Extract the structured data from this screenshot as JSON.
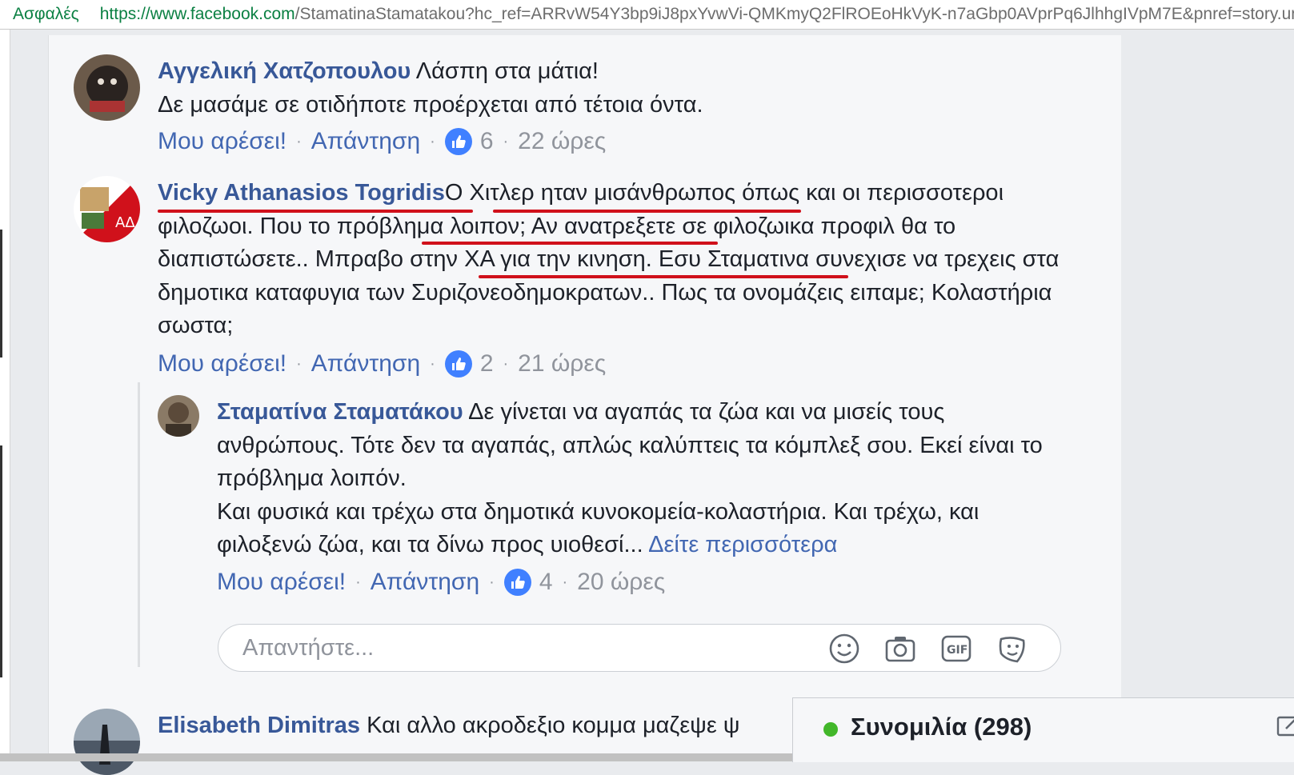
{
  "browser": {
    "secure_label": "Ασφαλές",
    "url_host": "https://www.facebook.com",
    "url_path": "/StamatinaStamatakou?hc_ref=ARRvW54Y3bp9iJ8pxYvwVi-QMKmyQ2FlROEoHkVyK-n7aGbp0AVprPq6JlhhgIVpM7E&pnref=story.un"
  },
  "comments": [
    {
      "author": "Αγγελική Χατζοπουλου",
      "text_line1": "Λάσπη στα μάτια!",
      "text_line2": "Δε μασάμε σε οτιδήποτε προέρχεται από τέτοια όντα.",
      "like_label": "Μου αρέσει!",
      "reply_label": "Απάντηση",
      "likes": "6",
      "time": "22 ώρες"
    },
    {
      "author": "Vicky Athanasios Togridis",
      "seg1": "Ο ",
      "seg2": "Χιτλερ ηταν μισάνθρωπος",
      "seg3": " όπως και οι περισσοτεροι φιλοζωοι. ",
      "seg4": "Που το πρόβλημα λοιπον;",
      "seg5": " Αν ανατρεξετε σε φιλοζωικα προφιλ θα το διαπιστώσετε.. ",
      "seg6": "Μπραβο στην ΧΑ για την κινηση",
      "seg7": ". Εσυ Σταματινα συνεχισε να τρεχεις στα δημοτικα καταφυγια των Συριζονεοδημοκρατων.. Πως τα ονομάζεις ειπαμε; Κολαστήρια σωστα;",
      "like_label": "Μου αρέσει!",
      "reply_label": "Απάντηση",
      "likes": "2",
      "time": "21 ώρες"
    },
    {
      "author": "Σταματίνα Σταματάκου",
      "text_line1": "Δε γίνεται να αγαπάς τα ζώα και να μισείς τους ανθρώπους. Τότε δεν τα αγαπάς, απλώς καλύπτεις τα κόμπλεξ σου. Εκεί είναι το πρόβλημα λοιπόν.",
      "text_line2": "Και φυσικά και τρέχω στα δημοτικά κυνοκομεία-κολαστήρια. Και τρέχω, και φιλοξενώ ζώα, και τα δίνω προς υιοθεσί...",
      "more": "Δείτε περισσότερα",
      "like_label": "Μου αρέσει!",
      "reply_label": "Απάντηση",
      "likes": "4",
      "time": "20 ώρες"
    },
    {
      "author": "Elisabeth Dimitras",
      "text": "Και αλλο ακροδεξιο κομμα μαζεψε ψ"
    }
  ],
  "reply_box": {
    "placeholder": "Απαντήστε..."
  },
  "chat": {
    "label": "Συνομιλία (298)"
  },
  "colors": {
    "link": "#385898",
    "underline": "#d0111b",
    "online": "#42b72a",
    "like": "#4080ff"
  }
}
